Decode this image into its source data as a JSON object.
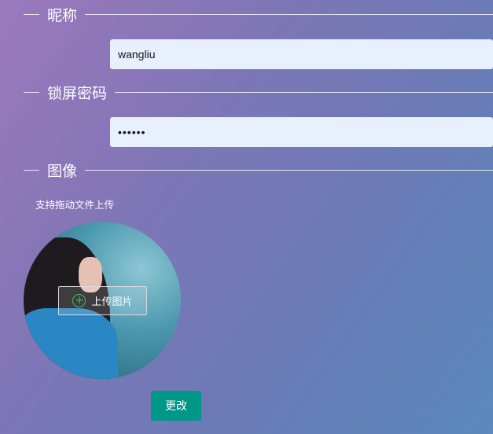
{
  "nickname": {
    "legend": "昵称",
    "value": "wangliu"
  },
  "lock_password": {
    "legend": "锁屏密码",
    "value": "••••••"
  },
  "avatar": {
    "legend": "图像",
    "hint": "支持拖动文件上传",
    "upload_label": "上传图片",
    "upload_icon": "plus-circle-icon"
  },
  "submit_label": "更改",
  "colors": {
    "button": "#009688",
    "input_bg": "#e8f0fe",
    "gradient_start": "#9c78bc",
    "gradient_end": "#5a89bb"
  }
}
